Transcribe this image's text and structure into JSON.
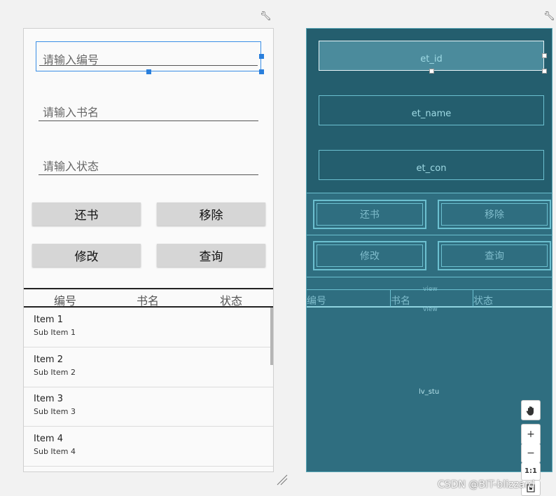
{
  "design": {
    "fields": [
      {
        "placeholder": "请输入编号"
      },
      {
        "placeholder": "请输入书名"
      },
      {
        "placeholder": "请输入状态"
      }
    ],
    "buttons": [
      {
        "label": "还书"
      },
      {
        "label": "移除"
      },
      {
        "label": "修改"
      },
      {
        "label": "查询"
      }
    ],
    "table_headers": [
      "编号",
      "书名",
      "状态"
    ],
    "list_items": [
      {
        "title": "Item 1",
        "subtitle": "Sub Item 1"
      },
      {
        "title": "Item 2",
        "subtitle": "Sub Item 2"
      },
      {
        "title": "Item 3",
        "subtitle": "Sub Item 3"
      },
      {
        "title": "Item 4",
        "subtitle": "Sub Item 4"
      }
    ]
  },
  "blueprint": {
    "field_ids": [
      "et_id",
      "et_name",
      "et_con"
    ],
    "buttons": [
      "还书",
      "移除",
      "修改",
      "查询"
    ],
    "view_label": "view",
    "table_headers": [
      "编号",
      "书名",
      "状态"
    ],
    "list_id": "lv_stu"
  },
  "toolbar": {
    "hand_icon": "hand-icon",
    "zoom_in": "+",
    "zoom_out": "−",
    "actual_size": "1:1"
  },
  "watermark": "CSDN @BIT-blizzard",
  "colors": {
    "selection": "#2a7fdc",
    "blueprint_bg": "#2f6e80",
    "blueprint_line": "#6cc0d0"
  }
}
